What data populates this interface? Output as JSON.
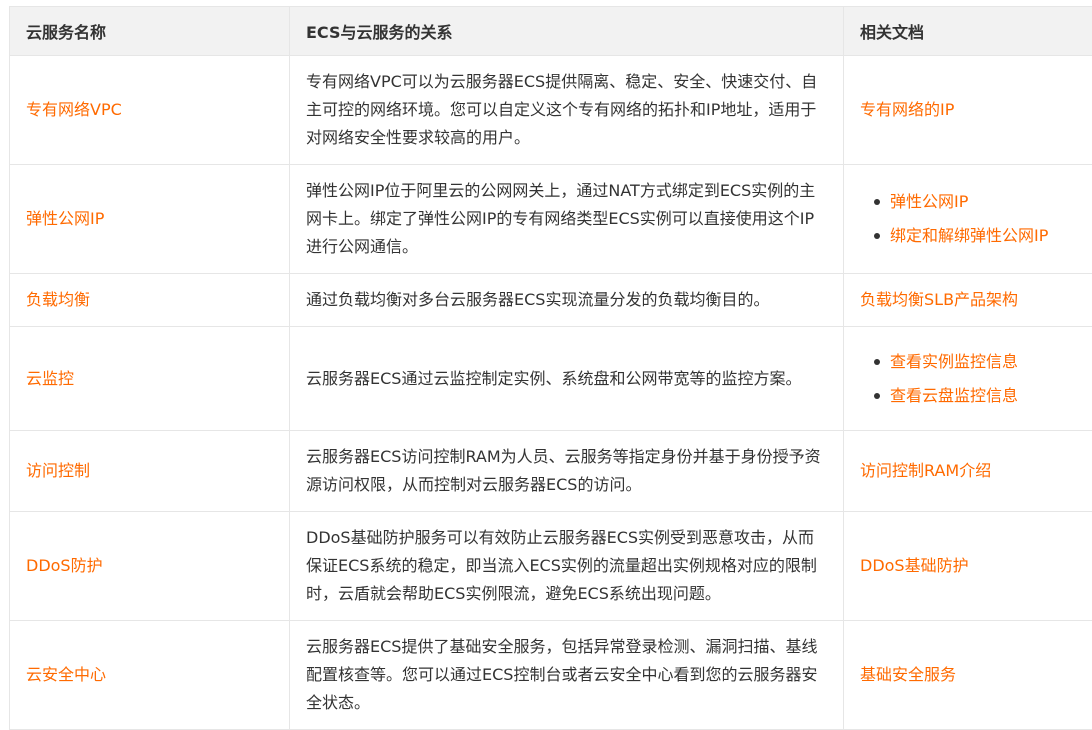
{
  "headers": {
    "service_name": "云服务名称",
    "relation": "ECS与云服务的关系",
    "docs": "相关文档"
  },
  "rows": [
    {
      "name": "专有网络VPC",
      "description": "专有网络VPC可以为云服务器ECS提供隔离、稳定、安全、快速交付、自主可控的网络环境。您可以自定义这个专有网络的拓扑和IP地址，适用于对网络安全性要求较高的用户。",
      "docs": [
        "专有网络的IP"
      ]
    },
    {
      "name": "弹性公网IP",
      "description": "弹性公网IP位于阿里云的公网网关上，通过NAT方式绑定到ECS实例的主网卡上。绑定了弹性公网IP的专有网络类型ECS实例可以直接使用这个IP进行公网通信。",
      "docs": [
        "弹性公网IP",
        "绑定和解绑弹性公网IP"
      ]
    },
    {
      "name": "负载均衡",
      "description": "通过负载均衡对多台云服务器ECS实现流量分发的负载均衡目的。",
      "docs": [
        "负载均衡SLB产品架构"
      ]
    },
    {
      "name": "云监控",
      "description": "云服务器ECS通过云监控制定实例、系统盘和公网带宽等的监控方案。",
      "docs": [
        "查看实例监控信息",
        "查看云盘监控信息"
      ]
    },
    {
      "name": "访问控制",
      "description": "云服务器ECS访问控制RAM为人员、云服务等指定身份并基于身份授予资源访问权限，从而控制对云服务器ECS的访问。",
      "docs": [
        "访问控制RAM介绍"
      ]
    },
    {
      "name": "DDoS防护",
      "description": "DDoS基础防护服务可以有效防止云服务器ECS实例受到恶意攻击，从而保证ECS系统的稳定，即当流入ECS实例的流量超出实例规格对应的限制时，云盾就会帮助ECS实例限流，避免ECS系统出现问题。",
      "docs": [
        "DDoS基础防护"
      ]
    },
    {
      "name": "云安全中心",
      "description": "云服务器ECS提供了基础安全服务，包括异常登录检测、漏洞扫描、基线配置核查等。您可以通过ECS控制台或者云安全中心看到您的云服务器安全状态。",
      "docs": [
        "基础安全服务"
      ]
    }
  ]
}
